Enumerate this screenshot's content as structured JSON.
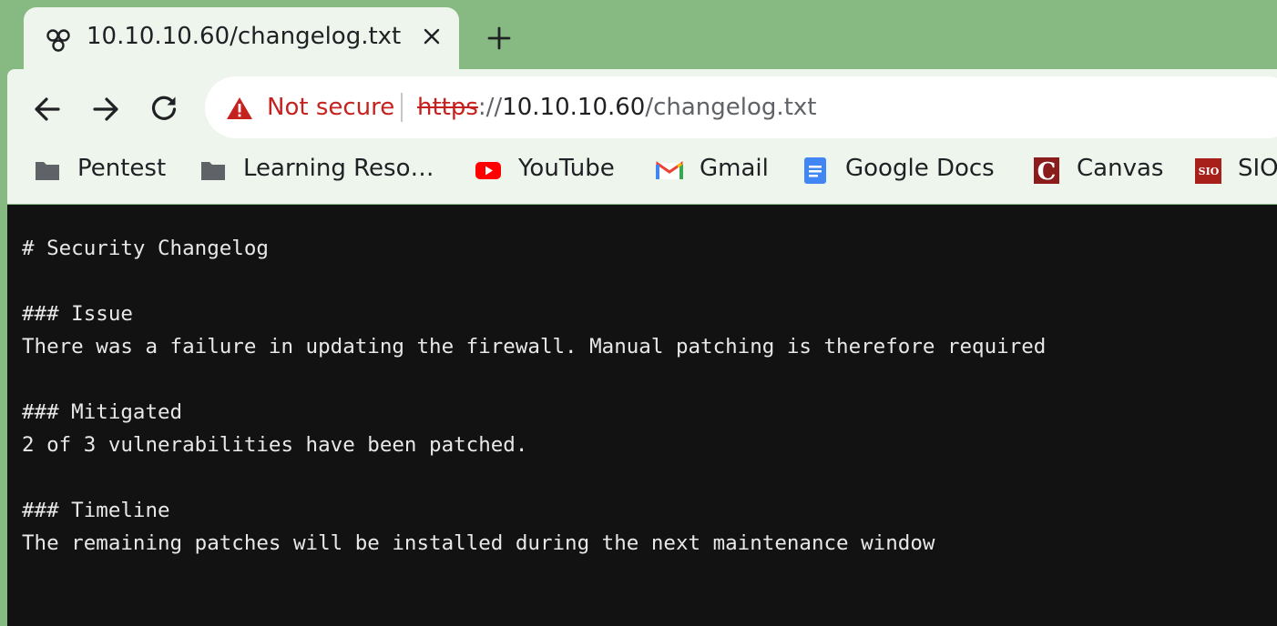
{
  "tab": {
    "title": "10.10.10.60/changelog.txt",
    "favicon": "network-favicon-icon"
  },
  "omnibox": {
    "security_label": "Not secure",
    "url_scheme": "https",
    "url_sep": "://",
    "url_host": "10.10.10.60",
    "url_path": "/changelog.txt"
  },
  "bookmarks": [
    {
      "label": "Pentest",
      "icon": "folder-icon"
    },
    {
      "label": "Learning Reso…",
      "icon": "folder-icon"
    },
    {
      "label": "YouTube",
      "icon": "youtube-icon"
    },
    {
      "label": "Gmail",
      "icon": "gmail-icon"
    },
    {
      "label": "Google Docs",
      "icon": "google-docs-icon"
    },
    {
      "label": "Canvas",
      "icon": "canvas-icon"
    },
    {
      "label": "SIO",
      "icon": "sio-icon"
    }
  ],
  "document": {
    "text": "# Security Changelog\n\n### Issue\nThere was a failure in updating the firewall. Manual patching is therefore required\n\n### Mitigated\n2 of 3 vulnerabilities have been patched.\n\n### Timeline\nThe remaining patches will be installed during the next maintenance window"
  },
  "colors": {
    "frame": "#87b982",
    "toolbar": "#eef5ec",
    "warning": "#c5221f",
    "content_bg": "#121212",
    "content_text": "#e8e8e8"
  }
}
